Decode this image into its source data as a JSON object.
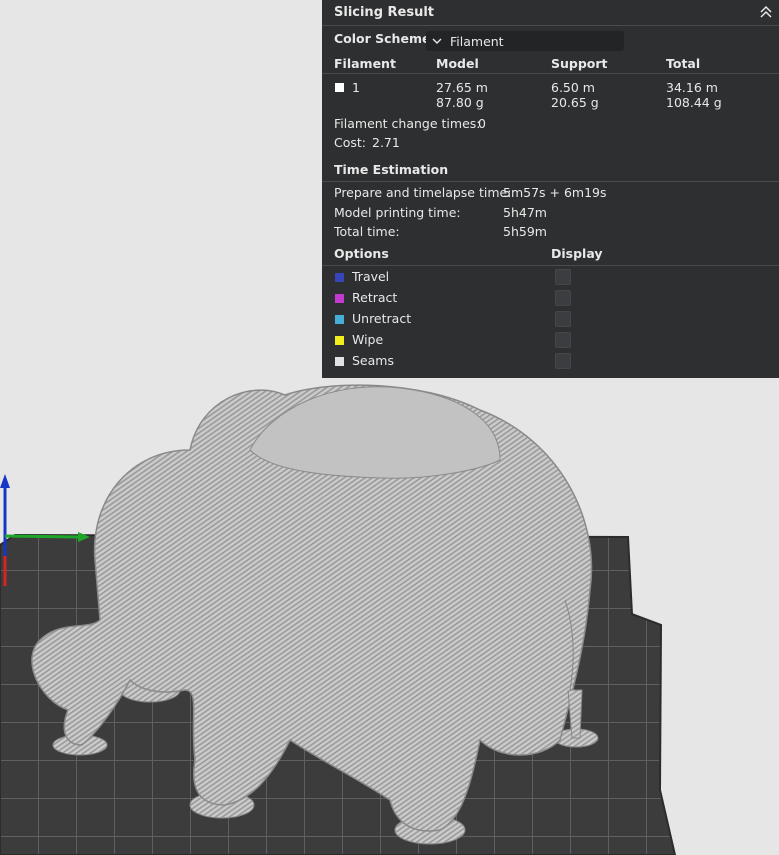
{
  "panel": {
    "title": "Slicing Result",
    "color_scheme_label": "Color Scheme",
    "color_scheme_value": "Filament",
    "filament_table": {
      "headers": [
        "Filament",
        "Model",
        "Support",
        "Total"
      ],
      "row": {
        "filament_id": "1",
        "swatch_color": "#ffffff",
        "model_length": "27.65 m",
        "model_weight": "87.80 g",
        "support_length": "6.50 m",
        "support_weight": "20.65 g",
        "total_length": "34.16 m",
        "total_weight": "108.44 g"
      }
    },
    "filament_change_label": "Filament change times:",
    "filament_change_value": "0",
    "cost_label": "Cost:",
    "cost_value": "2.71",
    "time_estimation_title": "Time Estimation",
    "times": [
      {
        "label": "Prepare and timelapse time:",
        "value": "5m57s + 6m19s"
      },
      {
        "label": "Model printing time:",
        "value": "5h47m"
      },
      {
        "label": "Total time:",
        "value": "5h59m"
      }
    ],
    "options_header": "Options",
    "display_header": "Display",
    "options": [
      {
        "label": "Travel",
        "color": "#3845b8"
      },
      {
        "label": "Retract",
        "color": "#c13ad1"
      },
      {
        "label": "Unretract",
        "color": "#44b0d8"
      },
      {
        "label": "Wipe",
        "color": "#f0ee1e"
      },
      {
        "label": "Seams",
        "color": "#e2e2e2"
      }
    ]
  }
}
